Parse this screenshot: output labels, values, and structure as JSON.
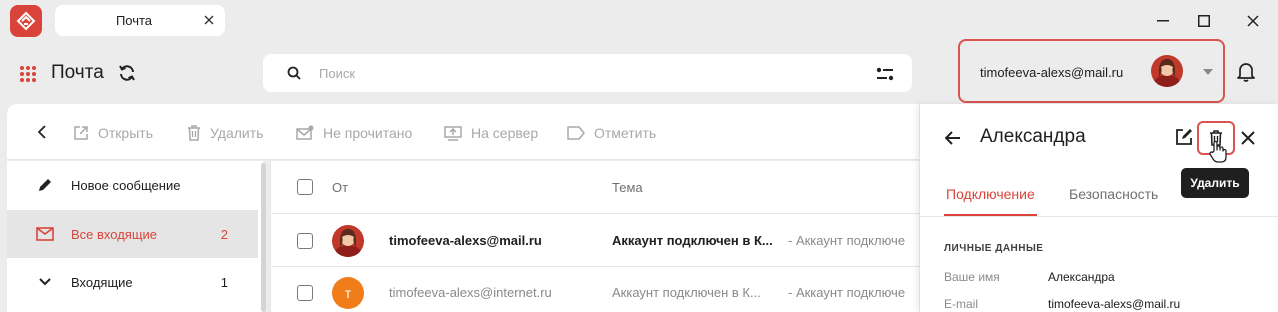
{
  "window": {
    "tab_title": "Почта",
    "controls": {
      "minimize": "minimize-icon",
      "maximize": "maximize-icon",
      "close": "close-icon"
    }
  },
  "header": {
    "app_title": "Почта",
    "search_placeholder": "Поиск",
    "account_email": "timofeeva-alexs@mail.ru"
  },
  "toolbar": {
    "items": [
      {
        "label": "Открыть",
        "icon": "open-external-icon"
      },
      {
        "label": "Удалить",
        "icon": "trash-icon"
      },
      {
        "label": "Не прочитано",
        "icon": "mail-unread-icon"
      },
      {
        "label": "На сервер",
        "icon": "upload-server-icon"
      },
      {
        "label": "Отметить",
        "icon": "tag-icon"
      }
    ]
  },
  "sidebar": {
    "items": [
      {
        "label": "Новое сообщение",
        "count": "",
        "icon": "pencil-icon"
      },
      {
        "label": "Все входящие",
        "count": "2",
        "icon": "inbox-icon",
        "active": true
      },
      {
        "label": "Входящие",
        "count": "1",
        "icon": "chevron-down-icon"
      }
    ]
  },
  "messages": {
    "columns": {
      "from": "От",
      "subject": "Тема"
    },
    "rows": [
      {
        "sender": "timofeeva-alexs@mail.ru",
        "subject": "Аккаунт подключен в К...",
        "preview": "- Аккаунт подключе",
        "unread": true,
        "avatar": "photo"
      },
      {
        "sender": "timofeeva-alexs@internet.ru",
        "subject": "Аккаунт подключен в К...",
        "preview": "- Аккаунт подключе",
        "unread": false,
        "avatar_letter": "т",
        "avatar_color": "#f07d1a"
      }
    ]
  },
  "panel": {
    "title": "Александра",
    "tabs": [
      "Подключение",
      "Безопасность"
    ],
    "section_title": "ЛИЧНЫЕ ДАННЫЕ",
    "fields": [
      {
        "label": "Ваше имя",
        "value": "Александра"
      },
      {
        "label": "E-mail",
        "value": "timofeeva-alexs@mail.ru"
      }
    ],
    "tooltip": "Удалить"
  },
  "colors": {
    "accent": "#d9443a",
    "highlight_border": "#d9534f",
    "background": "#ececec"
  }
}
